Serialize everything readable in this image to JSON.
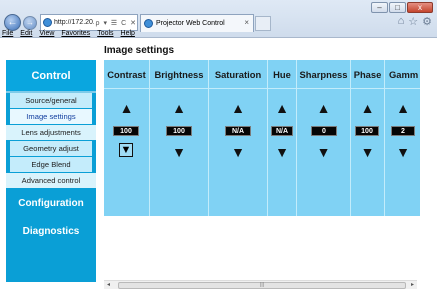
{
  "browser": {
    "address": "http://172.20.10....",
    "address_tools": "ρ ▾ ☰ C ✕",
    "tab_title": "Projector Web Control",
    "tab_close": "×",
    "back": "←",
    "forward": "→",
    "window_buttons": [
      "–",
      "□",
      "x"
    ],
    "right_icons": [
      "⌂",
      "☆",
      "⚙"
    ],
    "menu": [
      "File",
      "Edit",
      "View",
      "Favorites",
      "Tools",
      "Help"
    ]
  },
  "page": {
    "title": "Image settings"
  },
  "sidebar": {
    "header": "Control",
    "items": [
      "Source/general",
      "Image settings",
      "Lens adjustments",
      "Geometry adjust",
      "Edge Blend",
      "Advanced control"
    ],
    "active_item": "Image settings",
    "sections": [
      "Configuration",
      "Diagnostics"
    ]
  },
  "settings": {
    "up_symbol": "🡅",
    "down_symbol": "🡇",
    "columns": [
      {
        "label": "Contrast",
        "value": "100"
      },
      {
        "label": "Brightness",
        "value": "100"
      },
      {
        "label": "Saturation",
        "value": "N/A"
      },
      {
        "label": "Hue",
        "value": "N/A"
      },
      {
        "label": "Sharpness",
        "value": "0"
      },
      {
        "label": "Phase",
        "value": "100"
      },
      {
        "label": "Gamm",
        "value": "2"
      }
    ]
  },
  "scrollbar": {
    "left": "◂",
    "right": "▸",
    "grip": "|||"
  },
  "colors": {
    "sidebar_bg": "#0a9fd6",
    "panel_bg": "#80d2f4",
    "value_bg": "#050505"
  }
}
